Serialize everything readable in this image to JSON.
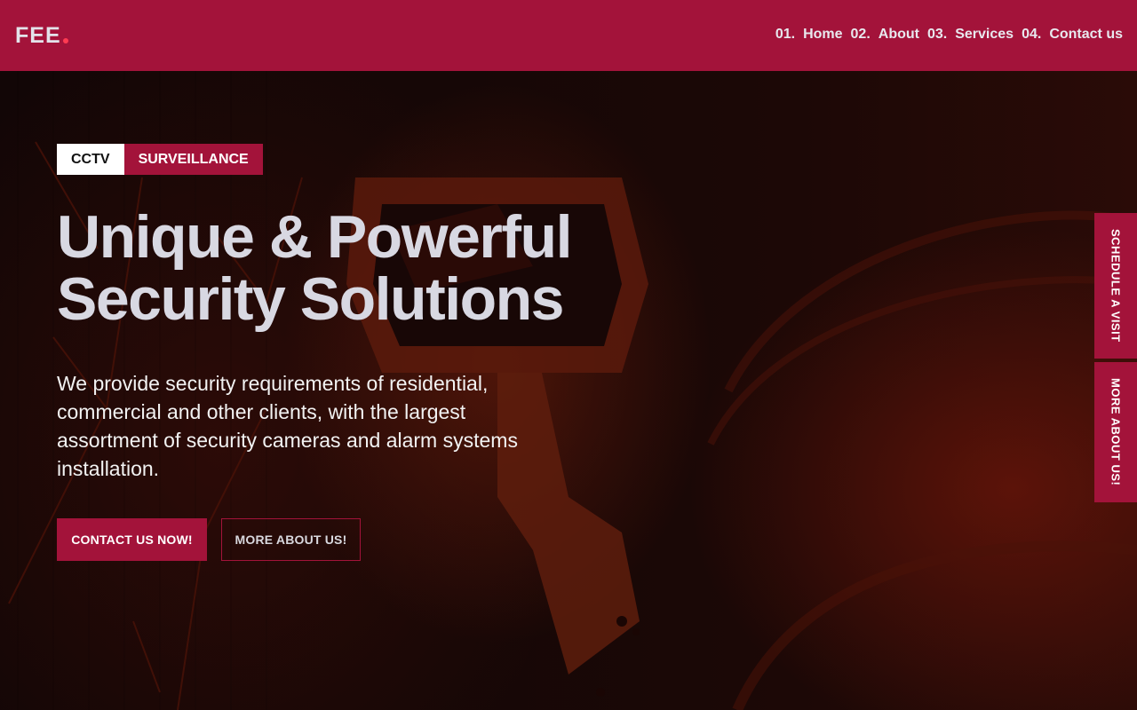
{
  "brand": {
    "logo_text": "FEE",
    "accent": "#a3133a",
    "dot_color": "#ff3b52"
  },
  "nav": {
    "items": [
      {
        "num": "01.",
        "label": "Home"
      },
      {
        "num": "02.",
        "label": "About"
      },
      {
        "num": "03.",
        "label": "Services"
      },
      {
        "num": "04.",
        "label": "Contact us"
      }
    ]
  },
  "hero": {
    "tags": [
      "CCTV",
      "SURVEILLANCE"
    ],
    "headline_line1": "Unique & Powerful",
    "headline_line2": "Security Solutions",
    "description": "We provide security requirements of residential, commercial and other clients, with the largest assortment of security cameras and alarm systems installation.",
    "primary_button": "CONTACT US NOW!",
    "secondary_button": "MORE ABOUT US!",
    "background_image": "cctv-camera-icon"
  },
  "side_tabs": [
    "SCHEDULE A VISIT",
    "MORE ABOUT US!"
  ]
}
